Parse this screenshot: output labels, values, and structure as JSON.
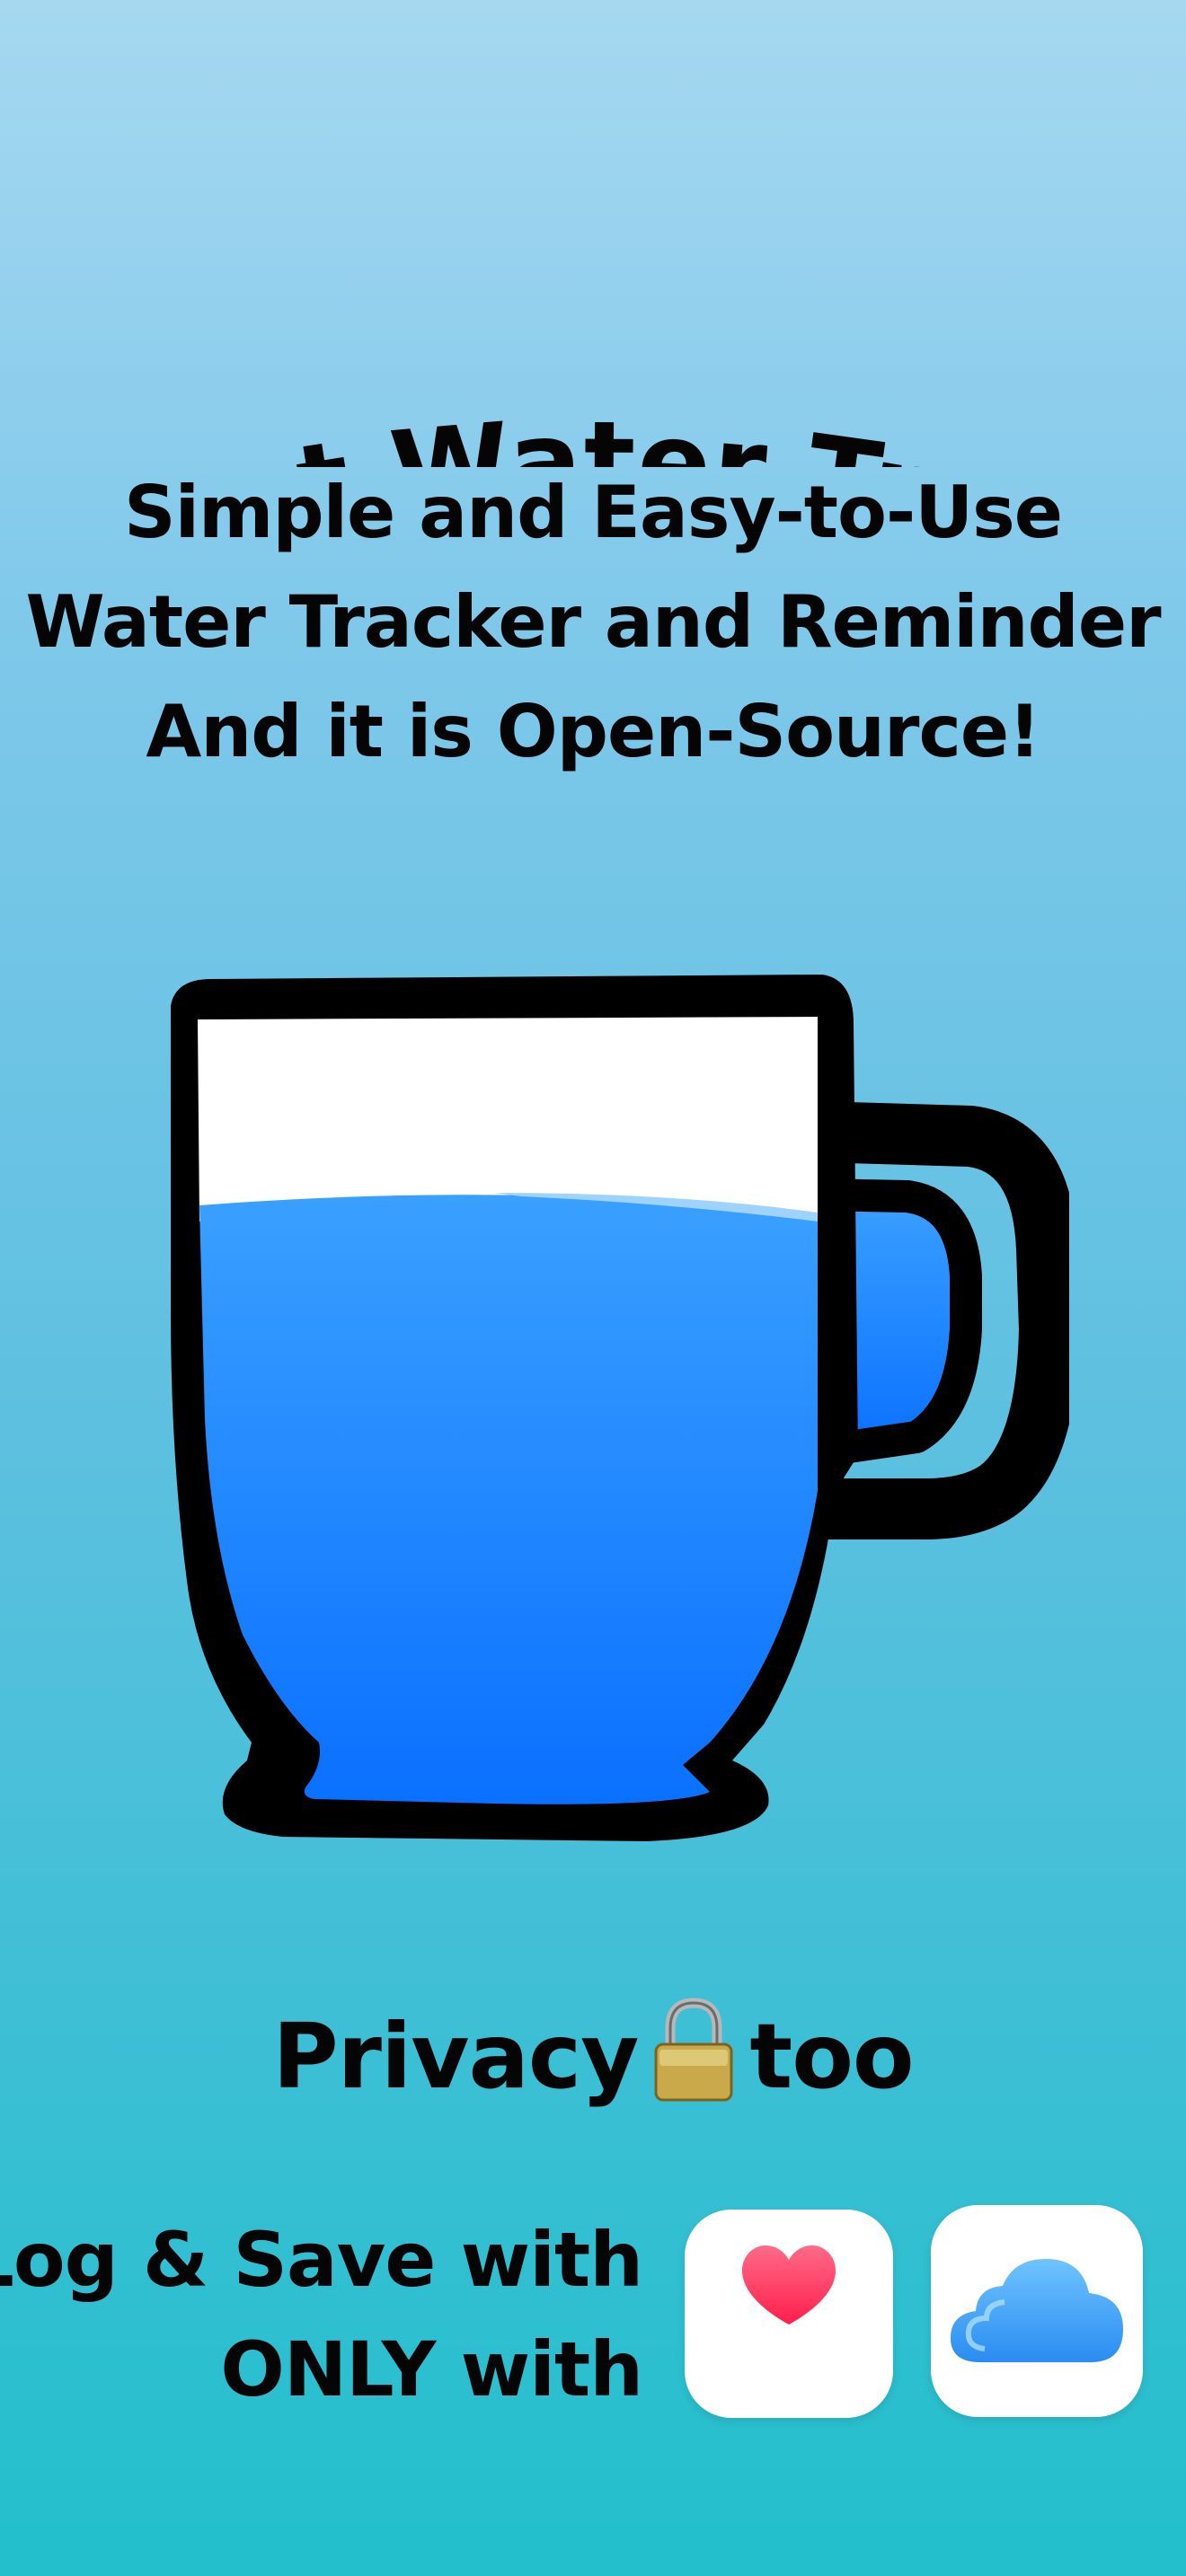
{
  "title": "Pocket Water Tracker",
  "subtitle": {
    "line1": "Simple and Easy-to-Use",
    "line2": "Water Tracker and Reminder",
    "line3": "And it is Open-Source!"
  },
  "mug": {
    "icon": "water-mug-icon",
    "water_fill_fraction": 0.75,
    "water_color": "#1a8cff",
    "outline_color": "#000000"
  },
  "privacy": {
    "before": "Privacy",
    "icon": "lock-icon",
    "after": "too"
  },
  "sync": {
    "line1": "Log & Save with",
    "line2": "ONLY with",
    "icons": [
      "apple-health-icon",
      "icloud-icon"
    ]
  },
  "colors": {
    "background_top": "#a6d8f0",
    "background_bottom": "#22bfcc",
    "heart": "#ff2d55",
    "cloud": "#2f9cf0"
  }
}
